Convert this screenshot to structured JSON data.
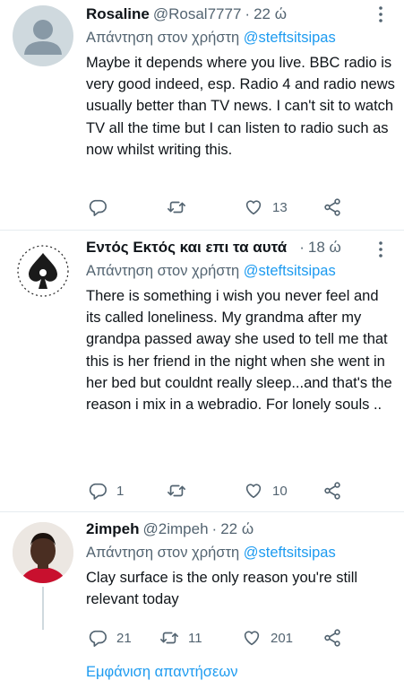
{
  "tweets": [
    {
      "name": "Rosaline",
      "handle": "@Rosal7777",
      "dot": "·",
      "time": "22 ώ",
      "reply_prefix": "Απάντηση στον χρήστη",
      "reply_mention": "@steftsitsipas",
      "text": "Maybe it depends where you live. BBC radio is very good indeed, esp. Radio 4 and radio news usually better than TV news. I can't sit to watch TV all the time but I can listen to radio such as now whilst writing this.",
      "replies": "",
      "retweets": "",
      "likes": "13"
    },
    {
      "name": "Εντός Εκτός και επι τα αυτά",
      "handle": "",
      "dot": "·",
      "time": "18 ώ",
      "reply_prefix": "Απάντηση στον χρήστη",
      "reply_mention": "@steftsitsipas",
      "text": "There is something i wish you never feel and its called loneliness. My grandma after my grandpa passed away she used to tell me that this is her friend in the night when she went in her bed but couldnt really sleep...and that's the reason i mix in a webradio. For lonely souls ..",
      "replies": "1",
      "retweets": "",
      "likes": "10"
    },
    {
      "name": "2impeh",
      "handle": "@2impeh",
      "dot": "·",
      "time": "22 ώ",
      "reply_prefix": "Απάντηση στον χρήστη",
      "reply_mention": "@steftsitsipas",
      "text": "Clay surface is the only reason you're still relevant today",
      "replies": "21",
      "retweets": "11",
      "likes": "201"
    }
  ],
  "show_replies": "Εμφάνιση απαντήσεων",
  "icons": [
    "more-icon",
    "reply-icon",
    "retweet-icon",
    "like-icon",
    "share-icon"
  ],
  "colors": {
    "accent": "#1d9bf0",
    "secondary_text": "#536471",
    "divider": "#e6ecf0"
  }
}
